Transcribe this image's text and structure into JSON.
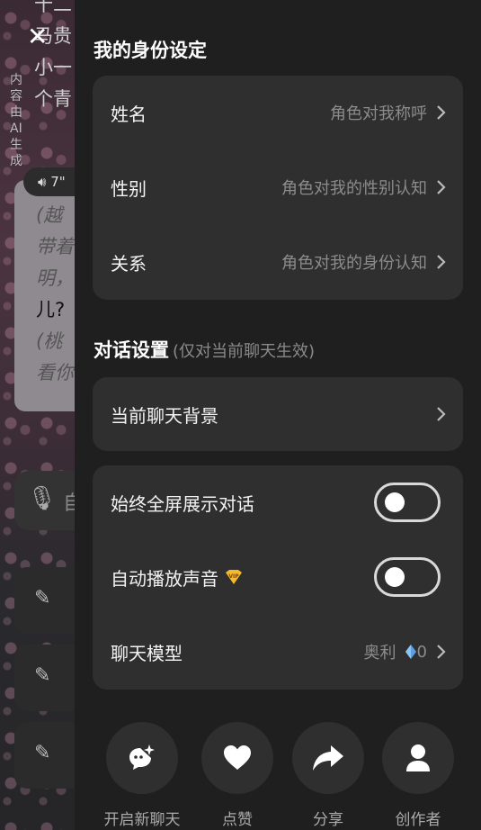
{
  "background": {
    "text_lines": [
      "十二",
      "马贵",
      "小一",
      "个青"
    ],
    "vertical_text": "内容由AI生成",
    "voice_duration": "7\"",
    "bubble_lines": [
      "(越",
      "带着",
      "明，",
      "儿?",
      "(桃",
      "看你"
    ],
    "mic_placeholder": "自"
  },
  "identity": {
    "title": "我的身份设定",
    "items": [
      {
        "label": "姓名",
        "hint": "角色对我称呼"
      },
      {
        "label": "性别",
        "hint": "角色对我的性别认知"
      },
      {
        "label": "关系",
        "hint": "角色对我的身份认知"
      }
    ]
  },
  "dialog": {
    "title": "对话设置",
    "subtitle": "(仅对当前聊天生效)",
    "background_label": "当前聊天背景",
    "fullscreen_label": "始终全屏展示对话",
    "fullscreen_on": false,
    "autoplay_label": "自动播放声音",
    "autoplay_on": false,
    "model_label": "聊天模型",
    "model_value": "奥利",
    "model_cost": "0"
  },
  "actions": [
    {
      "label": "开启新聊天",
      "icon": "new-chat-icon"
    },
    {
      "label": "点赞",
      "icon": "heart-icon"
    },
    {
      "label": "分享",
      "icon": "share-icon"
    },
    {
      "label": "创作者",
      "icon": "person-icon"
    }
  ],
  "colors": {
    "panel": "#1f1f1f",
    "card": "#2f2f2f",
    "vip": "#f5b82e",
    "gem": "#5aa0e6"
  }
}
